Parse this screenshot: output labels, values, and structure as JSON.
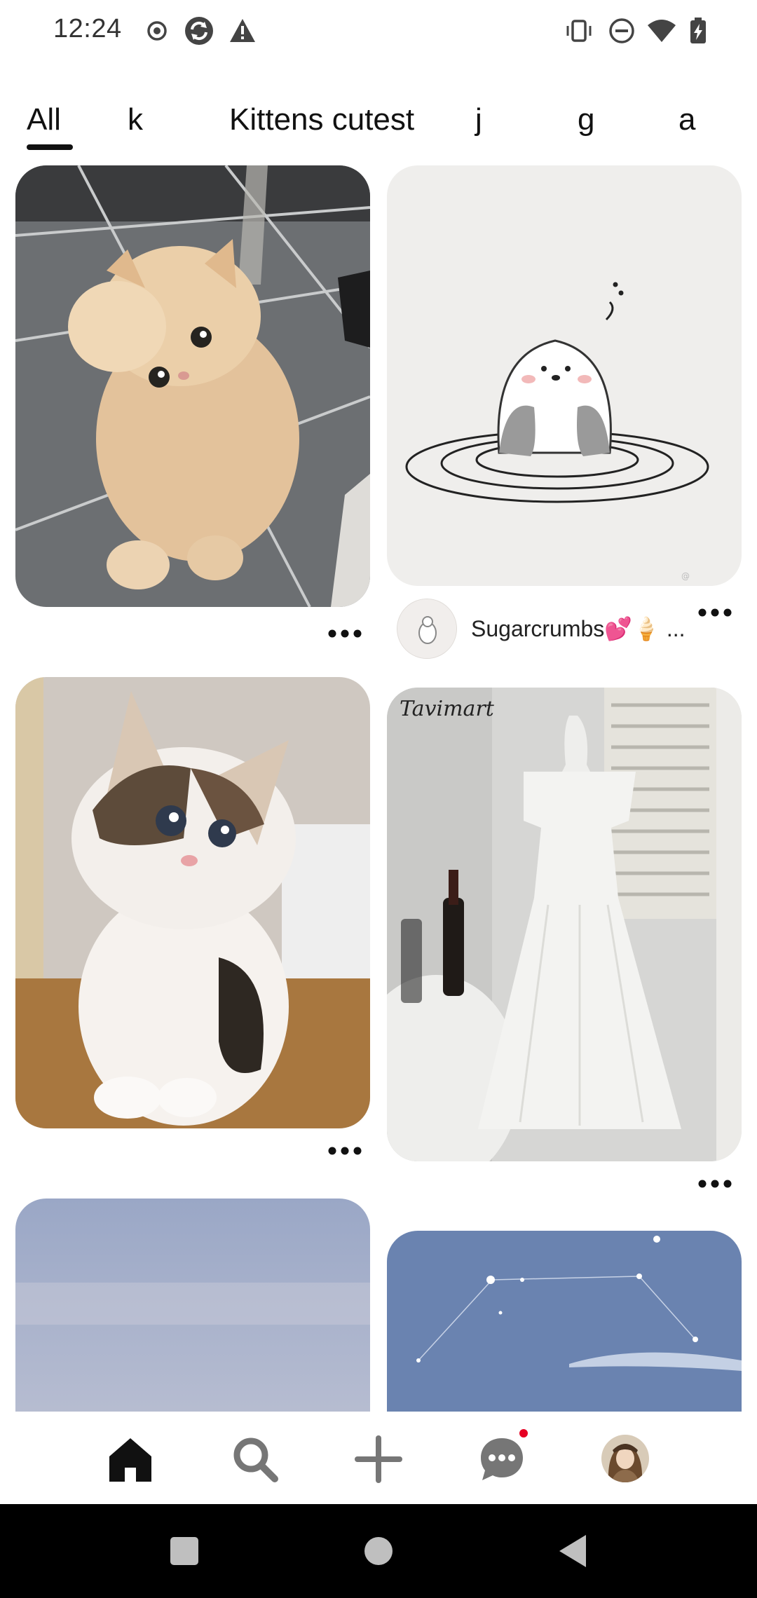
{
  "status_bar": {
    "time": "12:24",
    "icons_left": [
      "record-icon",
      "sync-app-icon",
      "warning-icon"
    ],
    "icons_right": [
      "vibrate-icon",
      "do-not-disturb-icon",
      "wifi-icon",
      "battery-icon"
    ]
  },
  "tabs": [
    {
      "label": "All",
      "selected": true
    },
    {
      "label": "k"
    },
    {
      "label": "Kittens cutest"
    },
    {
      "label": "j"
    },
    {
      "label": "g"
    },
    {
      "label": "a"
    }
  ],
  "pins": [
    {
      "name": "pin-fluffy-kitten",
      "more_icon": "more-horizontal-icon"
    },
    {
      "name": "pin-otter-drawing",
      "creator": "Sugarcrumbs💕🍦 ...",
      "more_icon": "more-horizontal-icon"
    },
    {
      "name": "pin-calico-kitten",
      "more_icon": "more-horizontal-icon"
    },
    {
      "name": "pin-white-dress",
      "watermark": "Tavimart",
      "more_icon": "more-horizontal-icon"
    },
    {
      "name": "pin-blue-sky"
    },
    {
      "name": "pin-constellation-sky"
    }
  ],
  "bottom_nav": {
    "items": [
      "home-icon",
      "search-icon",
      "create-icon",
      "messages-icon",
      "profile-avatar"
    ],
    "active": "home-icon",
    "notification_color": "#e60023"
  },
  "system_nav": [
    "recents-icon",
    "home-circle-icon",
    "back-icon"
  ]
}
